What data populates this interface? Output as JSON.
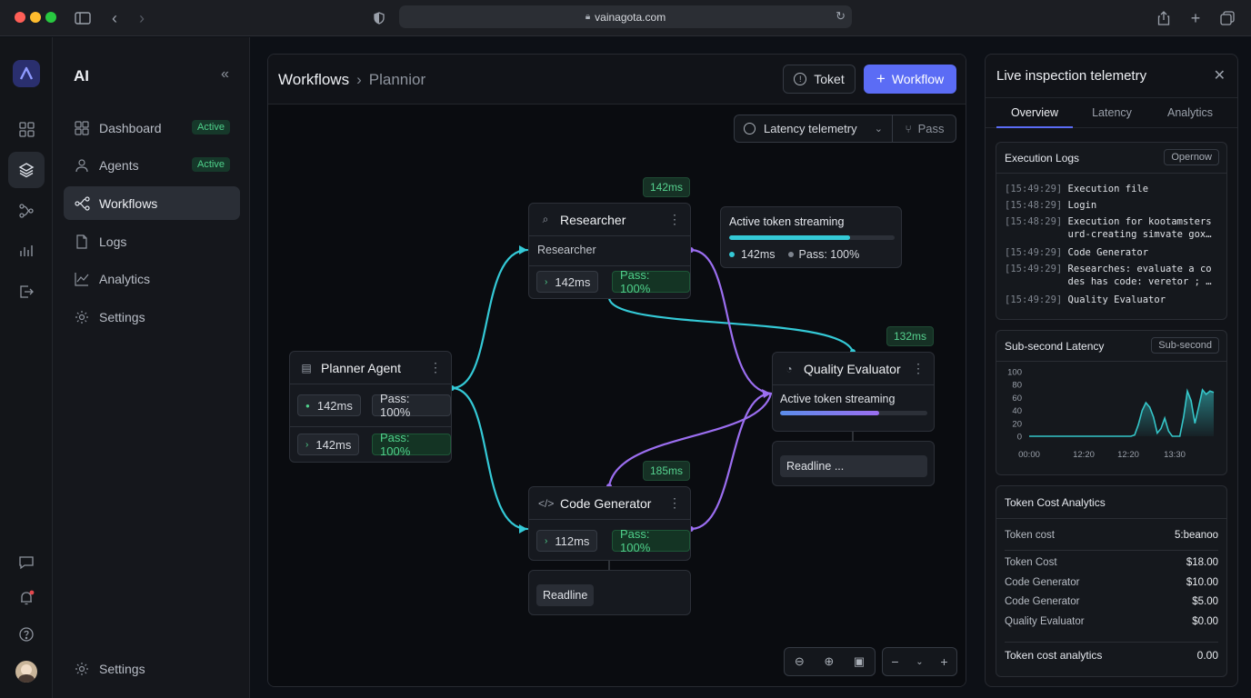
{
  "browser": {
    "url": "vainagota.com"
  },
  "sidebar": {
    "title": "AI",
    "items": [
      {
        "label": "Dashboard",
        "badge": "Active"
      },
      {
        "label": "Agents",
        "badge": "Active"
      },
      {
        "label": "Workflows",
        "badge": ""
      },
      {
        "label": "Logs",
        "badge": ""
      },
      {
        "label": "Analytics",
        "badge": ""
      },
      {
        "label": "Settings",
        "badge": ""
      }
    ],
    "footer_label": "Settings"
  },
  "main": {
    "breadcrumb_root": "Workflows",
    "breadcrumb_current": "Plannior",
    "toket_label": "Toket",
    "workflow_label": "Workflow",
    "telemetry_select": "Latency telemetry",
    "pass_label": "Pass"
  },
  "nodes": {
    "researcher": {
      "title": "Researcher",
      "subtitle": "Researcher",
      "latency": "142ms",
      "pass": "Pass: 100%",
      "badge": "142ms"
    },
    "streaming_popup": {
      "title": "Active token streaming",
      "latency": "142ms",
      "pass": "Pass: 100%",
      "progress": 0.73
    },
    "planner": {
      "title": "Planner Agent",
      "row1_latency": "142ms",
      "row1_pass": "Pass: 100%",
      "row2_latency": "142ms",
      "row2_pass": "Pass: 100%"
    },
    "quality": {
      "title": "Quality Evaluator",
      "streaming": "Active token streaming",
      "badge": "132ms",
      "progress": 0.67,
      "readline": "Readline ..."
    },
    "codegen": {
      "title": "Code Generator",
      "latency": "112ms",
      "pass": "Pass: 100%",
      "badge": "185ms",
      "readline": "Readline"
    }
  },
  "panel": {
    "title": "Live inspection telemetry",
    "tabs": [
      "Overview",
      "Latency",
      "Analytics"
    ],
    "active_tab": "Overview",
    "logs": {
      "title": "Execution Logs",
      "tag": "Opernow",
      "entries": [
        {
          "ts": "[15:49:29]",
          "text": "Execution file"
        },
        {
          "ts": "[15:48:29]",
          "text": "Login"
        },
        {
          "ts": "[15:48:29]",
          "text": "Execution for kootamsters\nurd-creating simvate gox…"
        },
        {
          "ts": "[15:49:29]",
          "text": "Code Generator"
        },
        {
          "ts": "[15:49:29]",
          "text": "Researches: evaluate a co\ndes has code: veretor ; …"
        },
        {
          "ts": "[15:49:29]",
          "text": "Quality Evaluator"
        }
      ]
    },
    "latency_card": {
      "title": "Sub-second Latency",
      "tag": "Sub-second"
    },
    "cost": {
      "title": "Token Cost Analytics",
      "header_label": "Token cost",
      "header_value": "5:beanoo",
      "rows": [
        {
          "label": "Token Cost",
          "value": "$18.00"
        },
        {
          "label": "Code Generator",
          "value": "$10.00"
        },
        {
          "label": "Code Generator",
          "value": "$5.00"
        },
        {
          "label": "Quality Evaluator",
          "value": "$0.00"
        }
      ],
      "footer_label": "Token cost analytics",
      "footer_value": "0.00"
    }
  },
  "chart_data": {
    "type": "area",
    "title": "",
    "x_tick_labels": [
      "00:00",
      "12:20",
      "12:20",
      "13:30"
    ],
    "y_ticks": [
      0,
      20,
      40,
      60,
      80,
      100
    ],
    "ylim": [
      0,
      100
    ],
    "x": [
      0,
      1,
      2,
      3,
      4,
      5,
      6,
      7,
      8,
      9,
      10,
      11,
      12,
      13,
      14,
      15,
      16,
      17,
      18,
      19,
      20,
      21,
      22,
      23,
      24,
      25,
      26,
      27,
      28,
      29,
      30,
      31,
      32,
      33,
      34,
      35,
      36,
      37,
      38,
      39,
      40,
      41,
      42,
      43,
      44,
      45,
      46,
      47,
      48,
      49
    ],
    "values": [
      0,
      0,
      0,
      0,
      0,
      0,
      0,
      0,
      0,
      0,
      0,
      0,
      0,
      0,
      0,
      0,
      0,
      0,
      0,
      0,
      0,
      0,
      0,
      0,
      0,
      0,
      0,
      0,
      2,
      18,
      40,
      52,
      45,
      30,
      5,
      12,
      28,
      8,
      0,
      0,
      0,
      30,
      70,
      55,
      20,
      45,
      72,
      65,
      70,
      68
    ],
    "color": "#35c6c9",
    "grid": false
  },
  "colors": {
    "accent": "#5b6cf5",
    "cyan": "#34c9d6",
    "purple": "#9b6ef0",
    "green": "#4fd18b"
  }
}
